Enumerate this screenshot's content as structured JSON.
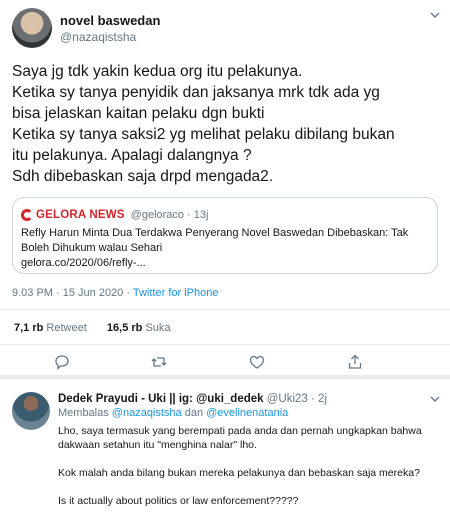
{
  "tweet": {
    "author_name": "novel baswedan",
    "author_handle": "@nazaqistsha",
    "lines": [
      "Saya jg tdk yakin kedua org itu pelakunya.",
      "Ketika sy tanya penyidik dan jaksanya mrk tdk ada yg",
      "bisa jelaskan kaitan pelaku dgn bukti",
      "Ketika sy tanya saksi2 yg melihat pelaku dibilang bukan",
      "itu pelakunya. Apalagi dalangnya ?",
      "Sdh dibebaskan saja drpd mengada2."
    ],
    "quote": {
      "source_name": "GELORA NEWS",
      "source_handle": "@geloraco",
      "source_time": "· 13j",
      "text_lines": [
        "Refly Harun Minta Dua Terdakwa Penyerang Novel Baswedan Dibebaskan: Tak",
        "Boleh Dihukum walau Sehari",
        "gelora.co/2020/06/refly-..."
      ]
    },
    "timestamp": "9.03 PM · 15 Jun 2020 · ",
    "via": "Twitter for iPhone",
    "retweets_count": "7,1 rb",
    "retweets_label": "Retweet",
    "likes_count": "16,5 rb",
    "likes_label": "Suka",
    "icons": [
      "reply-icon",
      "retweet-icon",
      "like-icon",
      "share-icon",
      "caret-down-icon"
    ]
  },
  "reply": {
    "author_name": "Dedek Prayudi - Uki || ig: @uki_dedek",
    "author_handle": "@Uki23",
    "time": " · 2j",
    "replying_prefix": "Membalas ",
    "mention1": "@nazaqistsha",
    "mention_sep": " dan ",
    "mention2": "@evelinenatania",
    "paragraphs": [
      "Lho, saya termasuk yang berempati pada anda dan pernah ungkapkan bahwa dakwaan setahun itu \"menghina nalar\" lho.",
      "Kok malah anda bilang bukan mereka pelakunya dan bebaskan saja mereka?",
      "Is it actually about politics or law enforcement?????"
    ]
  },
  "colors": {
    "accent": "#1b95e0",
    "muted": "#657786",
    "brand": "#d0262d"
  }
}
